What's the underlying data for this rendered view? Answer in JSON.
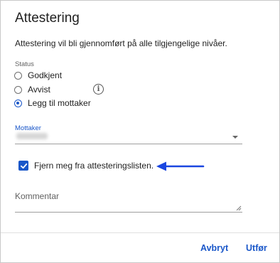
{
  "dialog": {
    "title": "Attestering",
    "description": "Attestering vil bli gjennomført på alle tilgjengelige nivåer."
  },
  "status": {
    "label": "Status",
    "options": [
      {
        "label": "Godkjent",
        "checked": false
      },
      {
        "label": "Avvist",
        "checked": false
      },
      {
        "label": "Legg til mottaker",
        "checked": true
      }
    ],
    "info_icon": "info-icon"
  },
  "recipient": {
    "label": "Mottaker",
    "value_obscured": true
  },
  "remove_checkbox": {
    "label": "Fjern meg fra attesteringslisten.",
    "checked": true
  },
  "annotation": {
    "arrow_color": "#1a46e0"
  },
  "comment": {
    "label": "Kommentar"
  },
  "actions": {
    "cancel_label": "Avbryt",
    "ok_label": "Utfør"
  },
  "colors": {
    "accent": "#1a57c9",
    "text": "#212121",
    "muted": "#616161"
  }
}
